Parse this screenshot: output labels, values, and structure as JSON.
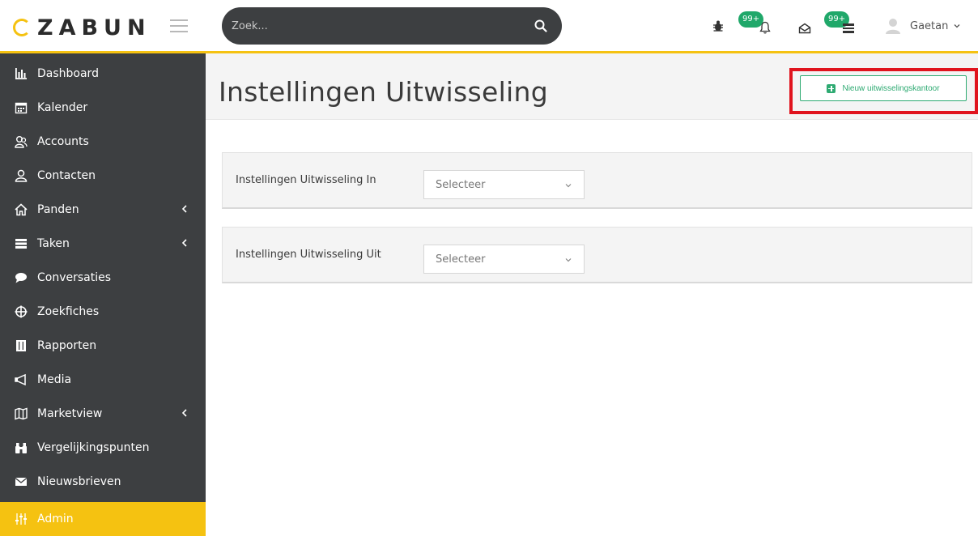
{
  "brand": {
    "name": "ZABUN"
  },
  "search": {
    "placeholder": "Zoek..."
  },
  "notifications": {
    "bug_badge": "99+",
    "mail_badge": "99+"
  },
  "user": {
    "name": "Gaetan"
  },
  "sidebar": {
    "items": [
      {
        "label": "Dashboard",
        "icon": "bar-chart-icon"
      },
      {
        "label": "Kalender",
        "icon": "calendar-icon"
      },
      {
        "label": "Accounts",
        "icon": "users-icon"
      },
      {
        "label": "Contacten",
        "icon": "user-icon"
      },
      {
        "label": "Panden",
        "icon": "home-icon",
        "submenu": true
      },
      {
        "label": "Taken",
        "icon": "tasks-icon",
        "submenu": true
      },
      {
        "label": "Conversaties",
        "icon": "chat-icon"
      },
      {
        "label": "Zoekfiches",
        "icon": "crosshair-icon"
      },
      {
        "label": "Rapporten",
        "icon": "book-icon"
      },
      {
        "label": "Media",
        "icon": "megaphone-icon"
      },
      {
        "label": "Marketview",
        "icon": "map-icon",
        "submenu": true
      },
      {
        "label": "Vergelijkingspunten",
        "icon": "binoculars-icon"
      },
      {
        "label": "Nieuwsbrieven",
        "icon": "envelope-icon"
      },
      {
        "label": "Admin",
        "icon": "sliders-icon",
        "active": true
      }
    ]
  },
  "main": {
    "title": "Instellingen Uitwisseling",
    "new_button_label": "Nieuw uitwisselingskantoor",
    "settings": [
      {
        "label": "Instellingen Uitwisseling In",
        "select_value": "Selecteer"
      },
      {
        "label": "Instellingen Uitwisseling Uit",
        "select_value": "Selecteer"
      }
    ]
  },
  "colors": {
    "accent": "#f5c211",
    "sidebar_bg": "#3d3f41",
    "success": "#2eaa72",
    "highlight": "#e0141e"
  }
}
